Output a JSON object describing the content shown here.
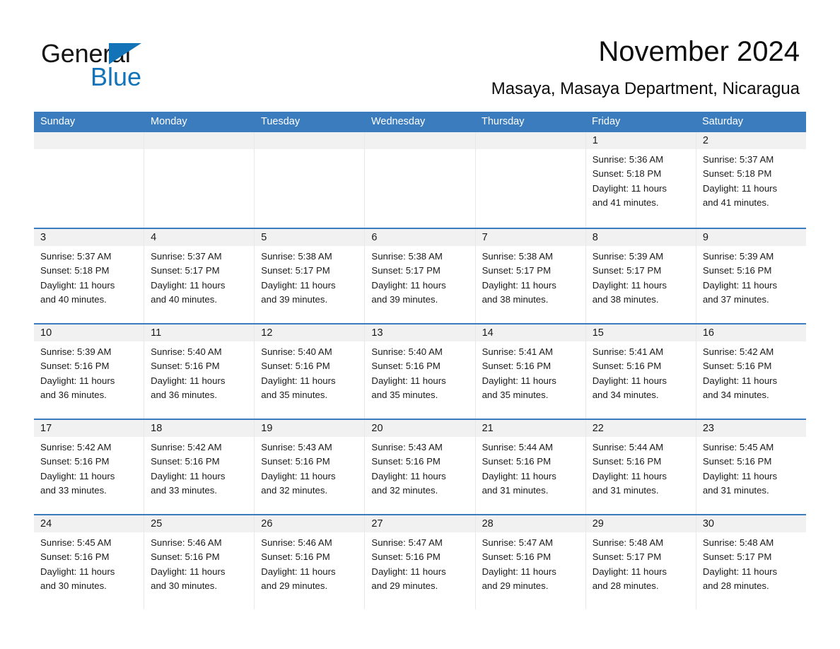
{
  "brand": {
    "name_part1": "General",
    "name_part2": "Blue",
    "triangle_color": "#1273b8",
    "blue_color": "#1273b8"
  },
  "header": {
    "month_title": "November 2024",
    "location": "Masaya, Masaya Department, Nicaragua"
  },
  "theme": {
    "header_blue": "#3a7cbe",
    "day_band_gray": "#f1f1f1",
    "row_divider_blue": "#3a7cbe"
  },
  "weekdays": [
    "Sunday",
    "Monday",
    "Tuesday",
    "Wednesday",
    "Thursday",
    "Friday",
    "Saturday"
  ],
  "weeks": [
    [
      {
        "day": "",
        "sunrise": "",
        "sunset": "",
        "daylight_line1": "",
        "daylight_line2": ""
      },
      {
        "day": "",
        "sunrise": "",
        "sunset": "",
        "daylight_line1": "",
        "daylight_line2": ""
      },
      {
        "day": "",
        "sunrise": "",
        "sunset": "",
        "daylight_line1": "",
        "daylight_line2": ""
      },
      {
        "day": "",
        "sunrise": "",
        "sunset": "",
        "daylight_line1": "",
        "daylight_line2": ""
      },
      {
        "day": "",
        "sunrise": "",
        "sunset": "",
        "daylight_line1": "",
        "daylight_line2": ""
      },
      {
        "day": "1",
        "sunrise": "Sunrise: 5:36 AM",
        "sunset": "Sunset: 5:18 PM",
        "daylight_line1": "Daylight: 11 hours",
        "daylight_line2": "and 41 minutes."
      },
      {
        "day": "2",
        "sunrise": "Sunrise: 5:37 AM",
        "sunset": "Sunset: 5:18 PM",
        "daylight_line1": "Daylight: 11 hours",
        "daylight_line2": "and 41 minutes."
      }
    ],
    [
      {
        "day": "3",
        "sunrise": "Sunrise: 5:37 AM",
        "sunset": "Sunset: 5:18 PM",
        "daylight_line1": "Daylight: 11 hours",
        "daylight_line2": "and 40 minutes."
      },
      {
        "day": "4",
        "sunrise": "Sunrise: 5:37 AM",
        "sunset": "Sunset: 5:17 PM",
        "daylight_line1": "Daylight: 11 hours",
        "daylight_line2": "and 40 minutes."
      },
      {
        "day": "5",
        "sunrise": "Sunrise: 5:38 AM",
        "sunset": "Sunset: 5:17 PM",
        "daylight_line1": "Daylight: 11 hours",
        "daylight_line2": "and 39 minutes."
      },
      {
        "day": "6",
        "sunrise": "Sunrise: 5:38 AM",
        "sunset": "Sunset: 5:17 PM",
        "daylight_line1": "Daylight: 11 hours",
        "daylight_line2": "and 39 minutes."
      },
      {
        "day": "7",
        "sunrise": "Sunrise: 5:38 AM",
        "sunset": "Sunset: 5:17 PM",
        "daylight_line1": "Daylight: 11 hours",
        "daylight_line2": "and 38 minutes."
      },
      {
        "day": "8",
        "sunrise": "Sunrise: 5:39 AM",
        "sunset": "Sunset: 5:17 PM",
        "daylight_line1": "Daylight: 11 hours",
        "daylight_line2": "and 38 minutes."
      },
      {
        "day": "9",
        "sunrise": "Sunrise: 5:39 AM",
        "sunset": "Sunset: 5:16 PM",
        "daylight_line1": "Daylight: 11 hours",
        "daylight_line2": "and 37 minutes."
      }
    ],
    [
      {
        "day": "10",
        "sunrise": "Sunrise: 5:39 AM",
        "sunset": "Sunset: 5:16 PM",
        "daylight_line1": "Daylight: 11 hours",
        "daylight_line2": "and 36 minutes."
      },
      {
        "day": "11",
        "sunrise": "Sunrise: 5:40 AM",
        "sunset": "Sunset: 5:16 PM",
        "daylight_line1": "Daylight: 11 hours",
        "daylight_line2": "and 36 minutes."
      },
      {
        "day": "12",
        "sunrise": "Sunrise: 5:40 AM",
        "sunset": "Sunset: 5:16 PM",
        "daylight_line1": "Daylight: 11 hours",
        "daylight_line2": "and 35 minutes."
      },
      {
        "day": "13",
        "sunrise": "Sunrise: 5:40 AM",
        "sunset": "Sunset: 5:16 PM",
        "daylight_line1": "Daylight: 11 hours",
        "daylight_line2": "and 35 minutes."
      },
      {
        "day": "14",
        "sunrise": "Sunrise: 5:41 AM",
        "sunset": "Sunset: 5:16 PM",
        "daylight_line1": "Daylight: 11 hours",
        "daylight_line2": "and 35 minutes."
      },
      {
        "day": "15",
        "sunrise": "Sunrise: 5:41 AM",
        "sunset": "Sunset: 5:16 PM",
        "daylight_line1": "Daylight: 11 hours",
        "daylight_line2": "and 34 minutes."
      },
      {
        "day": "16",
        "sunrise": "Sunrise: 5:42 AM",
        "sunset": "Sunset: 5:16 PM",
        "daylight_line1": "Daylight: 11 hours",
        "daylight_line2": "and 34 minutes."
      }
    ],
    [
      {
        "day": "17",
        "sunrise": "Sunrise: 5:42 AM",
        "sunset": "Sunset: 5:16 PM",
        "daylight_line1": "Daylight: 11 hours",
        "daylight_line2": "and 33 minutes."
      },
      {
        "day": "18",
        "sunrise": "Sunrise: 5:42 AM",
        "sunset": "Sunset: 5:16 PM",
        "daylight_line1": "Daylight: 11 hours",
        "daylight_line2": "and 33 minutes."
      },
      {
        "day": "19",
        "sunrise": "Sunrise: 5:43 AM",
        "sunset": "Sunset: 5:16 PM",
        "daylight_line1": "Daylight: 11 hours",
        "daylight_line2": "and 32 minutes."
      },
      {
        "day": "20",
        "sunrise": "Sunrise: 5:43 AM",
        "sunset": "Sunset: 5:16 PM",
        "daylight_line1": "Daylight: 11 hours",
        "daylight_line2": "and 32 minutes."
      },
      {
        "day": "21",
        "sunrise": "Sunrise: 5:44 AM",
        "sunset": "Sunset: 5:16 PM",
        "daylight_line1": "Daylight: 11 hours",
        "daylight_line2": "and 31 minutes."
      },
      {
        "day": "22",
        "sunrise": "Sunrise: 5:44 AM",
        "sunset": "Sunset: 5:16 PM",
        "daylight_line1": "Daylight: 11 hours",
        "daylight_line2": "and 31 minutes."
      },
      {
        "day": "23",
        "sunrise": "Sunrise: 5:45 AM",
        "sunset": "Sunset: 5:16 PM",
        "daylight_line1": "Daylight: 11 hours",
        "daylight_line2": "and 31 minutes."
      }
    ],
    [
      {
        "day": "24",
        "sunrise": "Sunrise: 5:45 AM",
        "sunset": "Sunset: 5:16 PM",
        "daylight_line1": "Daylight: 11 hours",
        "daylight_line2": "and 30 minutes."
      },
      {
        "day": "25",
        "sunrise": "Sunrise: 5:46 AM",
        "sunset": "Sunset: 5:16 PM",
        "daylight_line1": "Daylight: 11 hours",
        "daylight_line2": "and 30 minutes."
      },
      {
        "day": "26",
        "sunrise": "Sunrise: 5:46 AM",
        "sunset": "Sunset: 5:16 PM",
        "daylight_line1": "Daylight: 11 hours",
        "daylight_line2": "and 29 minutes."
      },
      {
        "day": "27",
        "sunrise": "Sunrise: 5:47 AM",
        "sunset": "Sunset: 5:16 PM",
        "daylight_line1": "Daylight: 11 hours",
        "daylight_line2": "and 29 minutes."
      },
      {
        "day": "28",
        "sunrise": "Sunrise: 5:47 AM",
        "sunset": "Sunset: 5:16 PM",
        "daylight_line1": "Daylight: 11 hours",
        "daylight_line2": "and 29 minutes."
      },
      {
        "day": "29",
        "sunrise": "Sunrise: 5:48 AM",
        "sunset": "Sunset: 5:17 PM",
        "daylight_line1": "Daylight: 11 hours",
        "daylight_line2": "and 28 minutes."
      },
      {
        "day": "30",
        "sunrise": "Sunrise: 5:48 AM",
        "sunset": "Sunset: 5:17 PM",
        "daylight_line1": "Daylight: 11 hours",
        "daylight_line2": "and 28 minutes."
      }
    ]
  ]
}
